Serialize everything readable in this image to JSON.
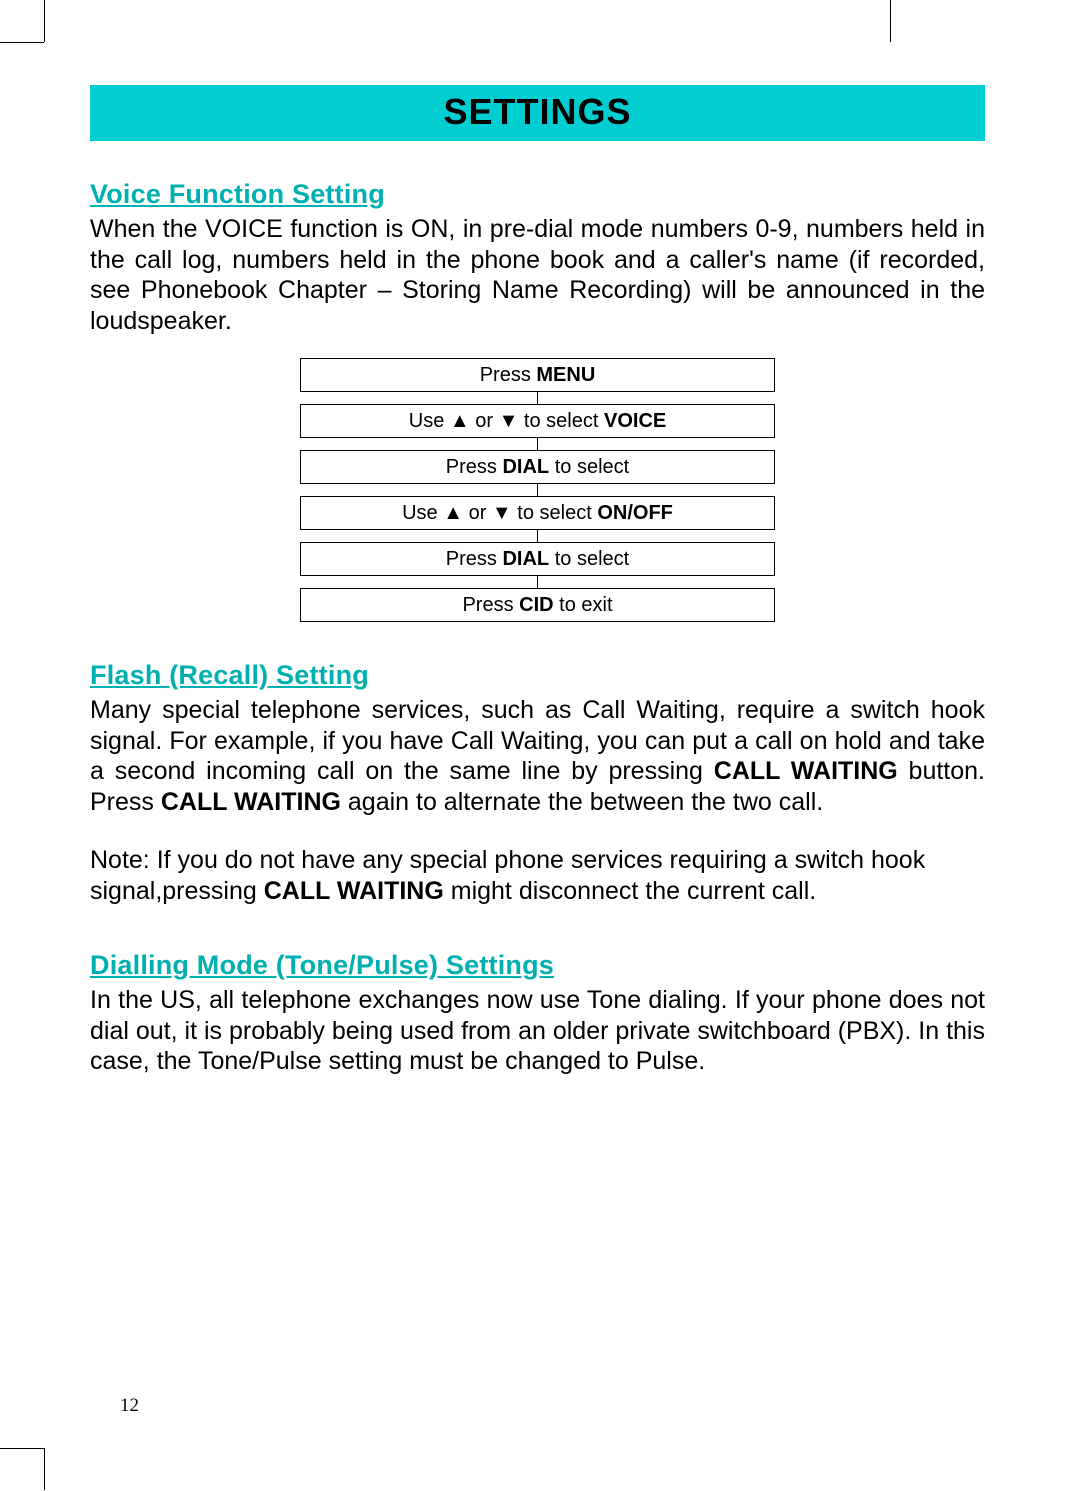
{
  "banner": {
    "title": "SETTINGS"
  },
  "voice": {
    "heading": "Voice Function Setting",
    "para": "When the VOICE function is ON, in pre-dial mode numbers 0-9, numbers held in the call log, numbers held in the phone book and a caller's name (if recorded, see Phonebook Chapter – Storing Name Recording) will be announced in the loudspeaker.",
    "steps": {
      "s1_pre": "Press ",
      "s1_b": "MENU",
      "s2_pre": "Use ▲ or ▼ to select ",
      "s2_b": "VOICE",
      "s3_pre": "Press ",
      "s3_b": "DIAL",
      "s3_post": "  to select",
      "s4_pre": "Use ▲ or ▼ to select ",
      "s4_b": "ON/OFF",
      "s5_pre": "Press ",
      "s5_b": "DIAL",
      "s5_post": "  to select",
      "s6_pre": "Press ",
      "s6_b": "CID",
      "s6_post": " to exit"
    }
  },
  "flash": {
    "heading": "Flash (Recall) Setting",
    "p1_a": "Many special telephone services, such as Call Waiting, require a switch hook signal. For example, if you have Call Waiting, you can put a call on hold and take a second incoming call on the same line by pressing ",
    "p1_b1": "CALL WAITING",
    "p1_c": " button. Press ",
    "p1_b2": "CALL WAITING",
    "p1_d": " again to alternate the between the two call.",
    "p2_a": "Note: If you do not have any special phone services requiring a switch hook signal,pressing ",
    "p2_b": "CALL WAITING",
    "p2_c": " might disconnect the current call."
  },
  "dial": {
    "heading": "Dialling Mode (Tone/Pulse) Settings",
    "para": "In the US, all telephone exchanges now use Tone dialing.  If your phone does not dial out, it is probably being used from an older private switchboard (PBX). In this case, the Tone/Pulse setting must be changed to Pulse."
  },
  "page_number": "12"
}
